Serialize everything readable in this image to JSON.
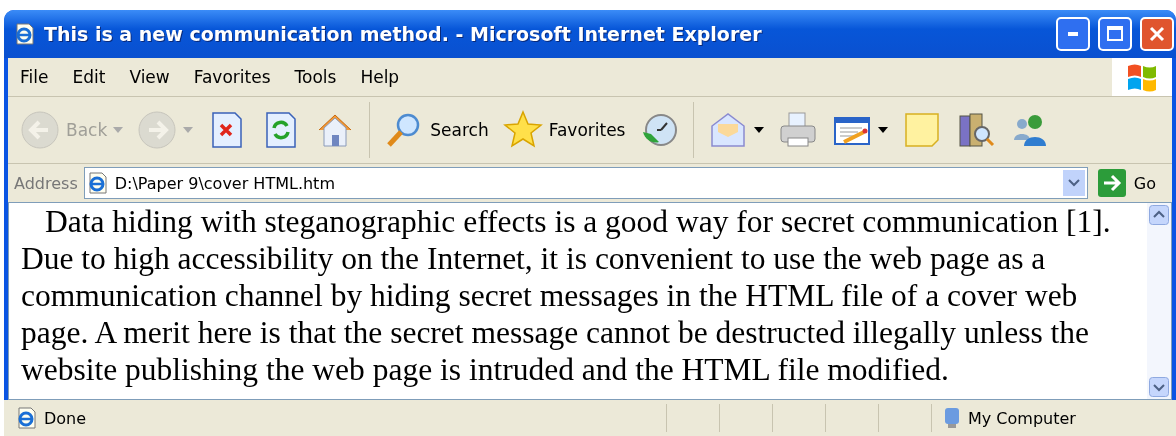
{
  "window": {
    "title": "This is a new communication method. - Microsoft Internet Explorer"
  },
  "menu": [
    "File",
    "Edit",
    "View",
    "Favorites",
    "Tools",
    "Help"
  ],
  "toolbar": [
    {
      "kind": "back",
      "label": "Back",
      "disabled": true,
      "dropdown": true
    },
    {
      "kind": "forward",
      "disabled": true,
      "dropdown": true
    },
    {
      "kind": "stop",
      "disabled": false,
      "dropdown": false
    },
    {
      "kind": "refresh",
      "disabled": false,
      "dropdown": false
    },
    {
      "kind": "home",
      "disabled": false,
      "dropdown": false
    },
    {
      "kind": "separator"
    },
    {
      "kind": "search",
      "label": "Search",
      "disabled": false,
      "dropdown": false
    },
    {
      "kind": "favorites",
      "label": "Favorites",
      "disabled": false,
      "dropdown": false
    },
    {
      "kind": "history",
      "disabled": false,
      "dropdown": false
    },
    {
      "kind": "separator"
    },
    {
      "kind": "mail",
      "disabled": false,
      "dropdown": true
    },
    {
      "kind": "print",
      "disabled": false,
      "dropdown": false
    },
    {
      "kind": "edit",
      "disabled": false,
      "dropdown": true
    },
    {
      "kind": "note",
      "disabled": false,
      "dropdown": false
    },
    {
      "kind": "research",
      "disabled": false,
      "dropdown": false
    },
    {
      "kind": "messenger",
      "disabled": false,
      "dropdown": false
    }
  ],
  "address": {
    "label": "Address",
    "value": "D:\\Paper 9\\cover HTML.htm",
    "go": "Go"
  },
  "content": {
    "paragraph": "Data hiding with steganographic effects is a good way for secret communication [1]. Due to high accessibility on the Internet, it is convenient to use the web page as a communication channel by hiding secret messages in the HTML file of a cover web page. A merit here is that the secret message cannot be destructed illegally unless the website publishing the web page is intruded and the HTML file modified."
  },
  "status_bar": {
    "text": "Done",
    "zone": "My Computer"
  }
}
